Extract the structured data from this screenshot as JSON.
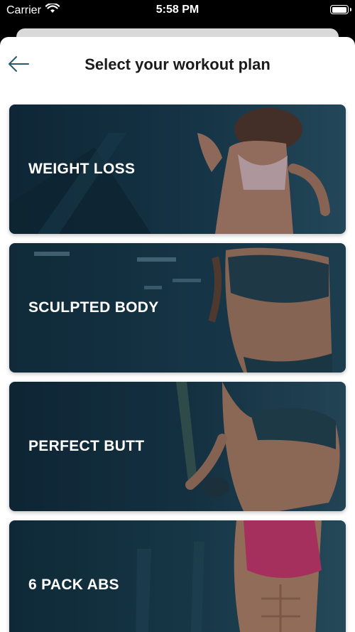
{
  "status_bar": {
    "carrier": "Carrier",
    "time": "5:58 PM",
    "battery_level": 1.0
  },
  "header": {
    "title": "Select your workout plan",
    "back_icon": "arrow-left-icon"
  },
  "plans": [
    {
      "label": "WEIGHT LOSS"
    },
    {
      "label": "SCULPTED BODY"
    },
    {
      "label": "PERFECT BUTT"
    },
    {
      "label": "6 PACK ABS"
    }
  ],
  "colors": {
    "card_overlay": "#0f2a3a",
    "card_highlight": "#3d6f86",
    "skin": "#c98a6a",
    "accent_pink": "#e0336b"
  }
}
